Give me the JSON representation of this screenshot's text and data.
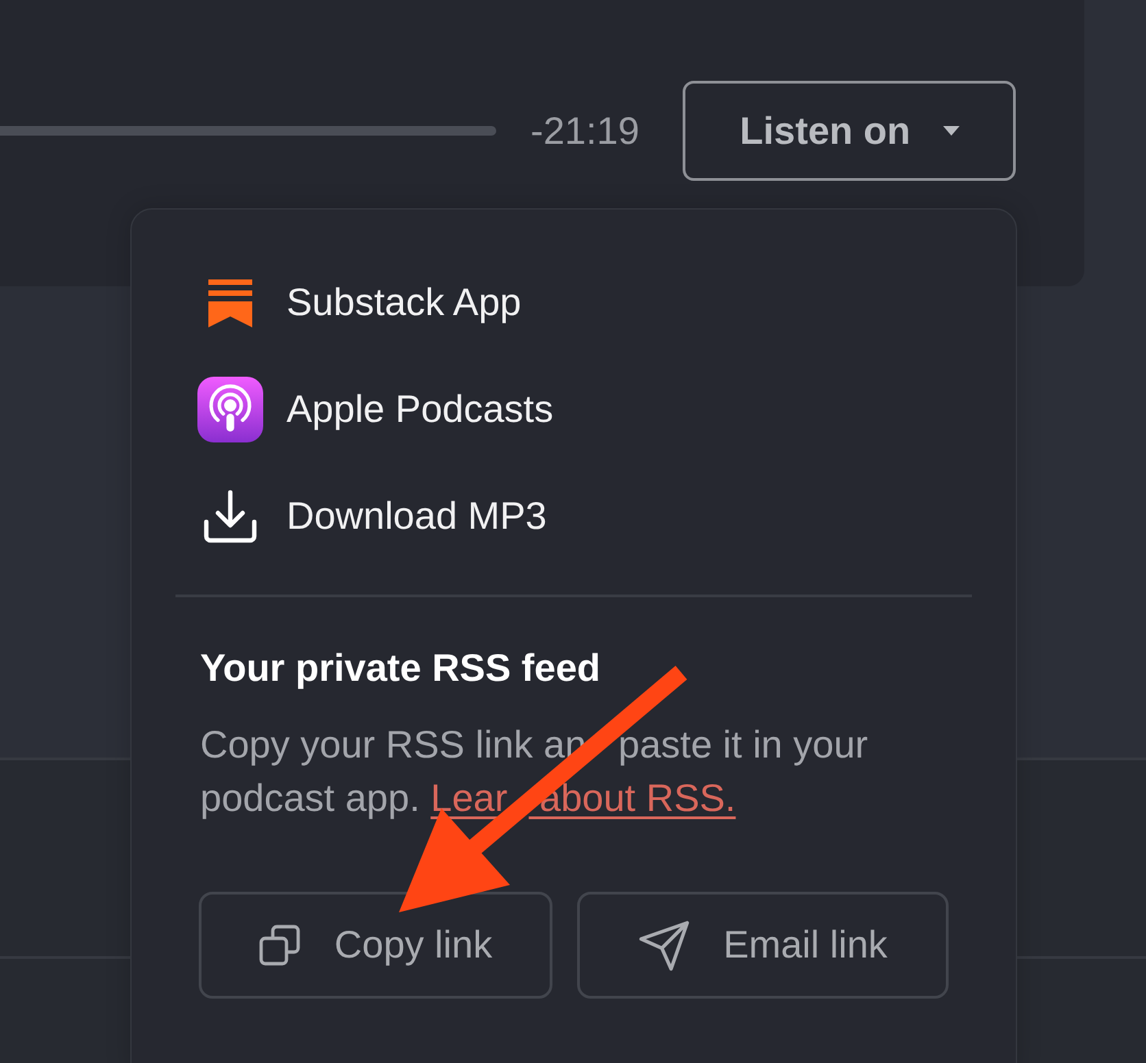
{
  "player": {
    "time_remaining": "-21:19",
    "listen_button": {
      "label": "Listen on",
      "expanded": true
    }
  },
  "menu": {
    "items": [
      {
        "kind": "substack",
        "label": "Substack App"
      },
      {
        "kind": "podcasts",
        "label": "Apple Podcasts"
      },
      {
        "kind": "download",
        "label": "Download MP3"
      }
    ],
    "rss": {
      "title": "Your private RSS feed",
      "text": [
        "Copy your RSS link an",
        "paste it in your podcast app."
      ],
      "link": [
        "Lear",
        "about RSS."
      ],
      "buttons": [
        {
          "kind": "copy",
          "label": "Copy link"
        },
        {
          "kind": "email",
          "label": "Email link"
        }
      ]
    }
  },
  "annotation": {
    "kind": "arrow"
  }
}
